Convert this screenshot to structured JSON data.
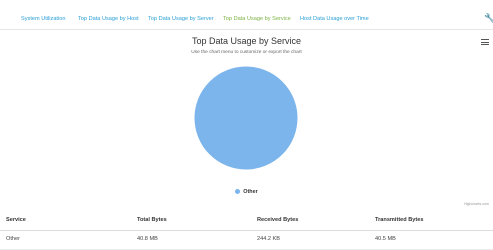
{
  "tabs": [
    {
      "label": "System Utilization",
      "active": false
    },
    {
      "label": "Top Data Usage by Host",
      "active": false
    },
    {
      "label": "Top Data Usage by Server",
      "active": false
    },
    {
      "label": "Top Data Usage by Service",
      "active": true
    },
    {
      "label": "Host Data Usage over Time",
      "active": false
    }
  ],
  "colors": {
    "accent": "#2a9fd6",
    "active_tab": "#7cb342",
    "pie": "#7cb5ec"
  },
  "chart_data": {
    "type": "pie",
    "title": "Top Data Usage by Service",
    "subtitle": "Use the chart menu to customize or export the chart",
    "series": [
      {
        "name": "Other",
        "values": [
          100
        ]
      }
    ],
    "categories": [
      "Other"
    ],
    "legend": "bottom-center",
    "credits": "Highcharts.com"
  },
  "table": {
    "headers": [
      "Service",
      "Total Bytes",
      "Received Bytes",
      "Transmitted Bytes"
    ],
    "rows": [
      [
        "Other",
        "40.8 MB",
        "244.2 KB",
        "40.5 MB"
      ]
    ]
  }
}
